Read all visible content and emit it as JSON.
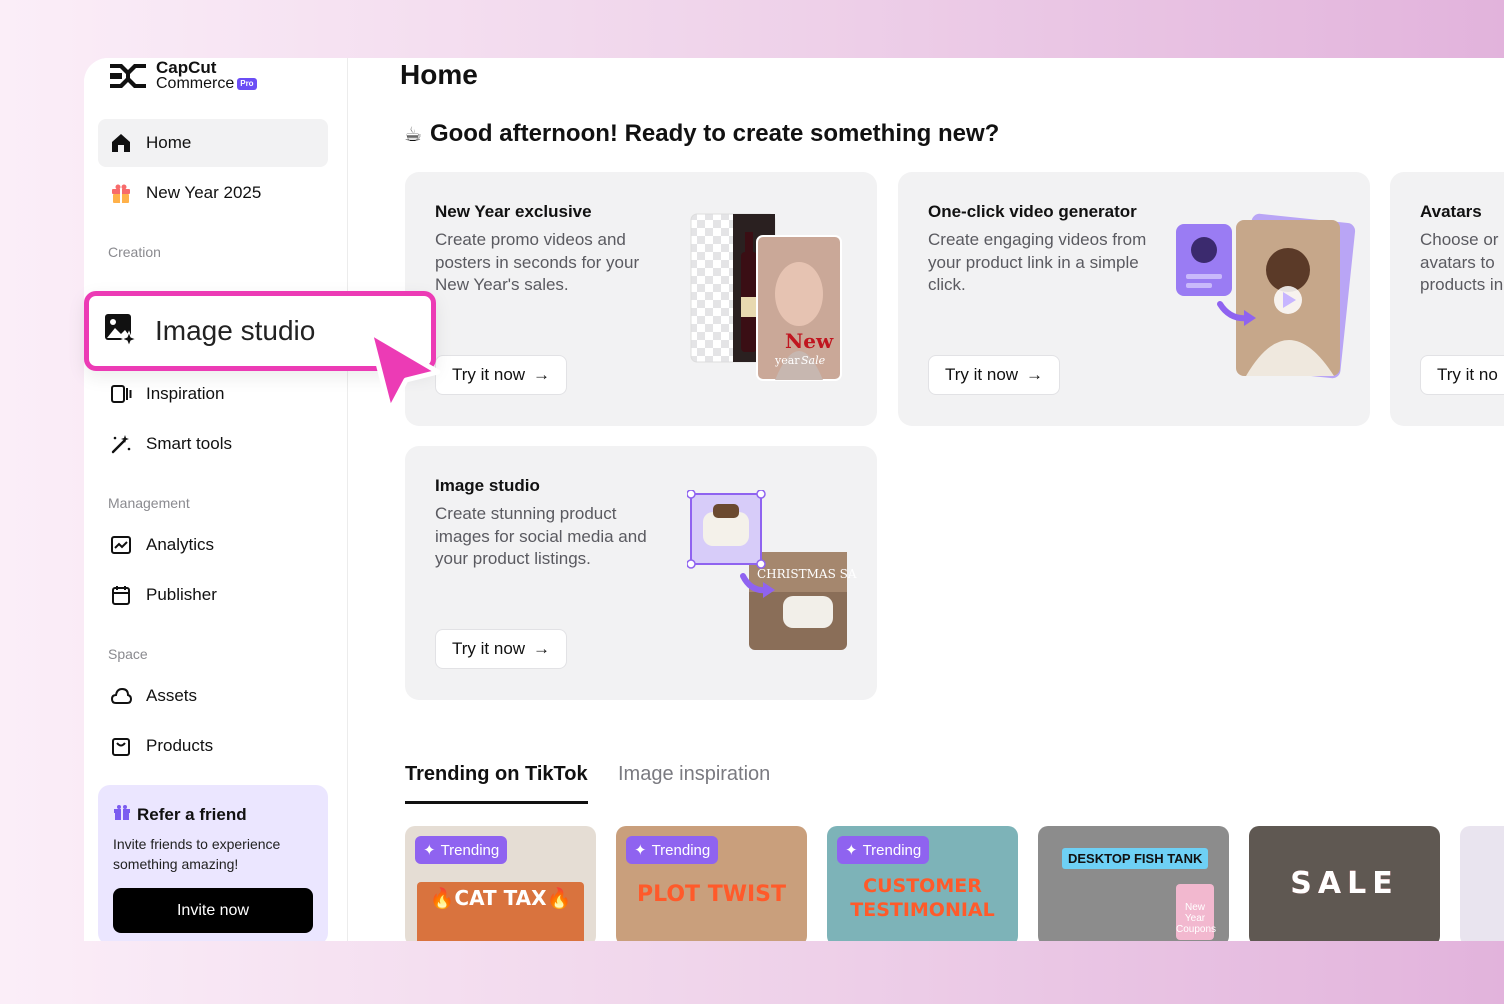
{
  "app": {
    "logo_line1": "CapCut",
    "logo_line2": "Commerce",
    "logo_badge": "Pro"
  },
  "sidebar": {
    "items_top": [
      {
        "label": "Home",
        "icon": "home-icon"
      },
      {
        "label": "New Year 2025",
        "icon": "gift-icon"
      }
    ],
    "section_creation": "Creation",
    "creation_items": [
      {
        "label": "Inspiration",
        "icon": "inspiration-icon"
      },
      {
        "label": "Smart tools",
        "icon": "magic-wand-icon"
      }
    ],
    "section_management": "Management",
    "management_items": [
      {
        "label": "Analytics",
        "icon": "analytics-icon"
      },
      {
        "label": "Publisher",
        "icon": "calendar-icon"
      }
    ],
    "section_space": "Space",
    "space_items": [
      {
        "label": "Assets",
        "icon": "cloud-icon"
      },
      {
        "label": "Products",
        "icon": "bag-icon"
      }
    ],
    "refer": {
      "title": "Refer a friend",
      "desc": "Invite friends to experience something amazing!",
      "button": "Invite now"
    }
  },
  "highlight": {
    "label": "Image studio",
    "icon": "image-studio-icon"
  },
  "main": {
    "title": "Home",
    "greeting_emoji": "☕",
    "greeting": "Good afternoon! Ready to create something new?",
    "cards": [
      {
        "title": "New Year exclusive",
        "desc": "Create promo videos and posters in seconds for your New Year's sales.",
        "button": "Try it now"
      },
      {
        "title": "One-click video generator",
        "desc": "Create engaging videos from your product link in a simple click.",
        "button": "Try it now"
      },
      {
        "title": "Avatars",
        "desc": "Choose or avatars to products in",
        "button": "Try it no"
      },
      {
        "title": "Image studio",
        "desc": "Create stunning product images for social media and your product listings.",
        "button": "Try it now"
      }
    ],
    "card_visuals": {
      "poster_text1": "New",
      "poster_text2": "year",
      "poster_text3": "Sale",
      "christmas_text": "CHRISTMAS SALE"
    },
    "tabs": [
      {
        "label": "Trending on TikTok",
        "active": true
      },
      {
        "label": "Image inspiration",
        "active": false
      }
    ],
    "thumbs": [
      {
        "badge": "Trending",
        "caption": "🔥CAT TAX🔥",
        "color": "#e8e0d8"
      },
      {
        "badge": "Trending",
        "caption": "PLOT TWIST",
        "color": "#c8a07a"
      },
      {
        "badge": "Trending",
        "caption": "CUSTOMER TESTIMONIAL",
        "color": "#7ab0b8"
      },
      {
        "badge": "",
        "caption": "DESKTOP FISH TANK",
        "tag": "New Year Coupons",
        "color": "#8a8a8a"
      },
      {
        "badge": "",
        "caption": "SALE",
        "color": "#6a625c"
      }
    ]
  },
  "colors": {
    "accent_pink": "#ec3bb5",
    "accent_purple": "#8f63f0",
    "brand_pro": "#6b4ef5"
  }
}
